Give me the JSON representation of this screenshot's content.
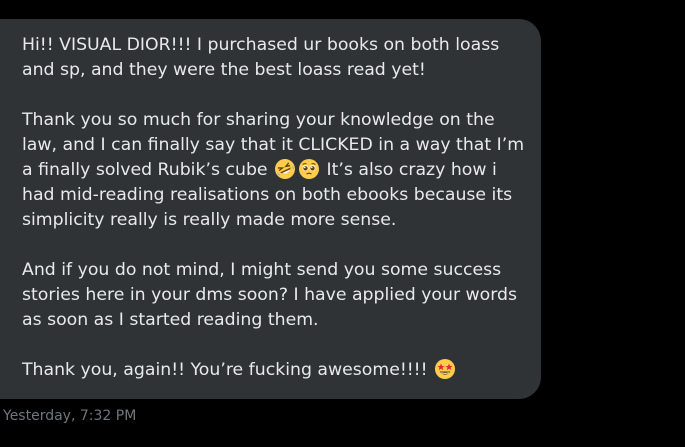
{
  "message": {
    "paragraphs": [
      {
        "text": "Hi!! VISUAL DIOR!!! I purchased ur books on both loass and sp, and they were the best loass read yet!"
      },
      {
        "text_before_emoji": "Thank you so much for sharing your knowledge on the law, and I can finally say that it CLICKED in a way that I’m a finally solved Rubik’s cube ",
        "emojis": [
          "rofl-emoji",
          "pleading-face-emoji"
        ],
        "text_after_emoji": " It’s also crazy how i had mid-reading realisations on both ebooks because its simplicity really is really made more sense."
      },
      {
        "text": "And if you do not mind, I might send you some success stories here in your dms soon? I have applied your words as soon as I started reading them."
      },
      {
        "text_before_emoji": "Thank you, again!! You’re fucking awesome!!!! ",
        "emojis": [
          "star-struck-emoji"
        ]
      }
    ],
    "timestamp": "Yesterday, 7:32 PM"
  },
  "colors": {
    "background": "#000000",
    "bubble": "#2f3336",
    "text": "#e7e9ea",
    "timestamp": "#71767b"
  }
}
